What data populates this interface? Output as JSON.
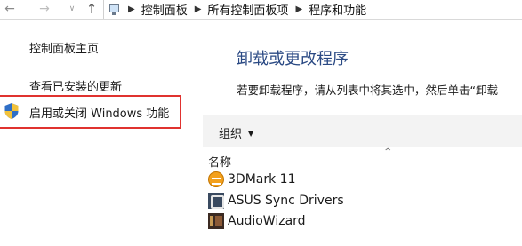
{
  "nav": {
    "back_icon": "arrow-left-icon",
    "forward_icon": "arrow-right-icon",
    "history_icon": "chevron-down-icon",
    "up_icon": "arrow-up-icon"
  },
  "breadcrumb": {
    "location_icon": "control-panel-icon",
    "items": [
      "控制面板",
      "所有控制面板项",
      "程序和功能"
    ]
  },
  "sidebar": {
    "home": "控制面板主页",
    "updates": "查看已安装的更新",
    "features": "启用或关闭 Windows 功能",
    "features_icon": "shield-icon",
    "highlight_color": "#e0322f"
  },
  "main": {
    "title": "卸载或更改程序",
    "description": "若要卸载程序，请从列表中将其选中，然后单击“卸载",
    "toolbar": {
      "organize": "组织"
    },
    "column_name": "名称",
    "programs": [
      {
        "name": "3DMark 11",
        "icon": "3dmark-icon"
      },
      {
        "name": "ASUS Sync Drivers",
        "icon": "asus-icon"
      },
      {
        "name": "AudioWizard",
        "icon": "audiowizard-icon"
      }
    ]
  },
  "colors": {
    "title": "#2b4a84",
    "toolbar_bg": "#f3f3f3"
  }
}
